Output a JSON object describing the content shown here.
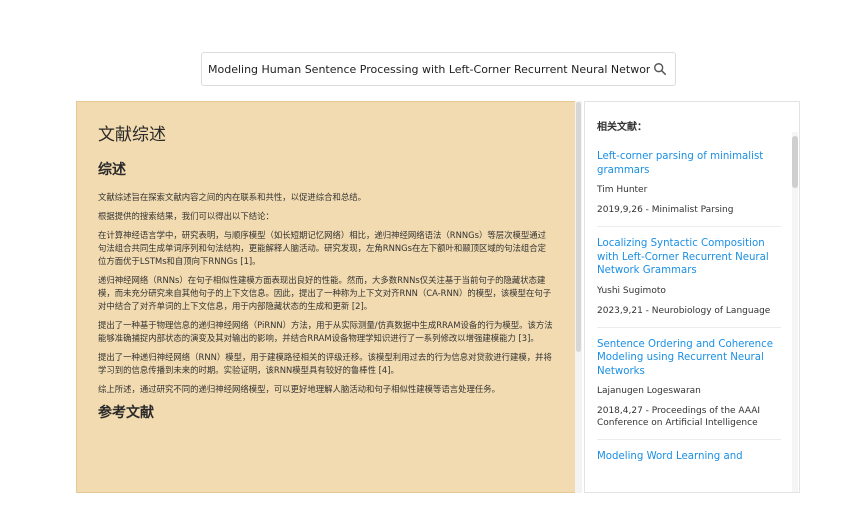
{
  "search": {
    "value": "Modeling Human Sentence Processing with Left-Corner Recurrent Neural Network Grammar"
  },
  "main": {
    "page_title": "文献综述",
    "section_title": "综述",
    "paragraphs": [
      "文献综述旨在探索文献内容之间的内在联系和共性，以促进综合和总结。",
      "根据提供的搜索结果，我们可以得出以下结论：",
      "在计算神经语言学中，研究表明，与顺序模型（如长短期记忆网络）相比，递归神经网络语法（RNNGs）等层次模型通过句法组合共同生成单词序列和句法结构，更能解释人脑活动。研究发现，左角RNNGs在左下额叶和颞顶区域的句法组合定位方面优于LSTMs和自顶向下RNNGs [1]。",
      "递归神经网络（RNNs）在句子相似性建模方面表现出良好的性能。然而，大多数RNNs仅关注基于当前句子的隐藏状态建模，而未充分研究来自其他句子的上下文信息。因此，提出了一种称为上下文对齐RNN（CA-RNN）的模型，该模型在句子对中结合了对齐单词的上下文信息，用于内部隐藏状态的生成和更新 [2]。",
      "提出了一种基于物理信息的递归神经网络（PiRNN）方法，用于从实际测量/仿真数据中生成RRAM设备的行为模型。该方法能够准确捕捉内部状态的演变及其对输出的影响，并结合RRAM设备物理学知识进行了一系列修改以增强建模能力 [3]。",
      "提出了一种递归神经网络（RNN）模型，用于建模路径相关的评级迁移。该模型利用过去的行为信息对贷款进行建模，并将学习到的信息传播到未来的时期。实验证明，该RNN模型具有较好的鲁棒性 [4]。",
      "综上所述，通过研究不同的递归神经网络模型，可以更好地理解人脑活动和句子相似性建模等语言处理任务。"
    ],
    "refs_title": "参考文献"
  },
  "sidebar": {
    "header": "相关文献：",
    "refs": [
      {
        "title": "Left-corner parsing of minimalist grammars",
        "author": "Tim Hunter",
        "meta": "2019,9,26 - Minimalist Parsing"
      },
      {
        "title": "Localizing Syntactic Composition with Left-Corner Recurrent Neural Network Grammars",
        "author": "Yushi Sugimoto",
        "meta": "2023,9,21 - Neurobiology of Language"
      },
      {
        "title": "Sentence Ordering and Coherence Modeling using Recurrent Neural Networks",
        "author": "Lajanugen Logeswaran",
        "meta": "2018,4,27 - Proceedings of the AAAI Conference on Artificial Intelligence"
      },
      {
        "title": "Modeling Word Learning and",
        "author": "",
        "meta": ""
      }
    ]
  },
  "colors": {
    "main_bg": "#f2dbb0",
    "link": "#1a8fe3"
  },
  "icons": {
    "search": "search-icon"
  }
}
